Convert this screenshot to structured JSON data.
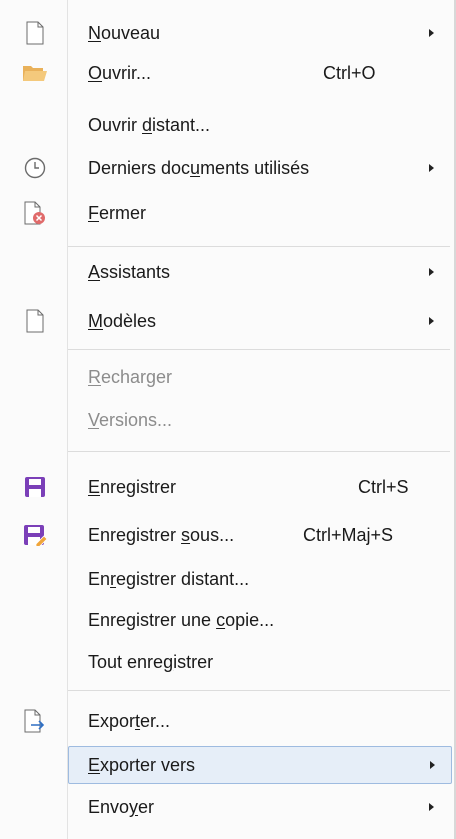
{
  "menu": {
    "items": [
      {
        "pre": "",
        "u": "N",
        "post": "ouveau",
        "shortcut": "",
        "icon": "new-document-icon"
      },
      {
        "pre": "",
        "u": "O",
        "post": "uvrir...",
        "shortcut": "Ctrl+O",
        "icon": "open-folder-icon"
      },
      {
        "pre": "Ouvrir ",
        "u": "d",
        "post": "istant...",
        "shortcut": ""
      },
      {
        "pre": "Derniers doc",
        "u": "u",
        "post": "ments utilisés",
        "shortcut": "",
        "icon": "clock-icon"
      },
      {
        "pre": "",
        "u": "F",
        "post": "ermer",
        "shortcut": "",
        "icon": "close-document-icon"
      },
      {
        "pre": "",
        "u": "A",
        "post": "ssistants",
        "shortcut": ""
      },
      {
        "pre": "",
        "u": "M",
        "post": "odèles",
        "shortcut": "",
        "icon": "templates-document-icon"
      },
      {
        "pre": "",
        "u": "R",
        "post": "echarger",
        "shortcut": ""
      },
      {
        "pre": "",
        "u": "V",
        "post": "ersions...",
        "shortcut": ""
      },
      {
        "pre": "",
        "u": "E",
        "post": "nregistrer",
        "shortcut": "Ctrl+S",
        "icon": "save-icon"
      },
      {
        "pre": "Enregistrer ",
        "u": "s",
        "post": "ous...",
        "shortcut": "Ctrl+Maj+S",
        "icon": "save-as-icon"
      },
      {
        "pre": "En",
        "u": "r",
        "post": "egistrer distant...",
        "shortcut": ""
      },
      {
        "pre": "Enregistrer une ",
        "u": "c",
        "post": "opie...",
        "shortcut": ""
      },
      {
        "pre": "Tout enre",
        "u": "g",
        "post": "istrer",
        "shortcut": ""
      },
      {
        "pre": "Expor",
        "u": "t",
        "post": "er...",
        "shortcut": "",
        "icon": "export-icon"
      },
      {
        "pre": "",
        "u": "E",
        "post": "xporter vers",
        "shortcut": ""
      },
      {
        "pre": "Envo",
        "u": "y",
        "post": "er",
        "shortcut": ""
      }
    ],
    "colors": {
      "highlight_bg": "#e6eef8",
      "highlight_border": "#9ebbe0",
      "disabled_text": "#8c8c8c",
      "save_icon": "#7b3fb8"
    }
  }
}
